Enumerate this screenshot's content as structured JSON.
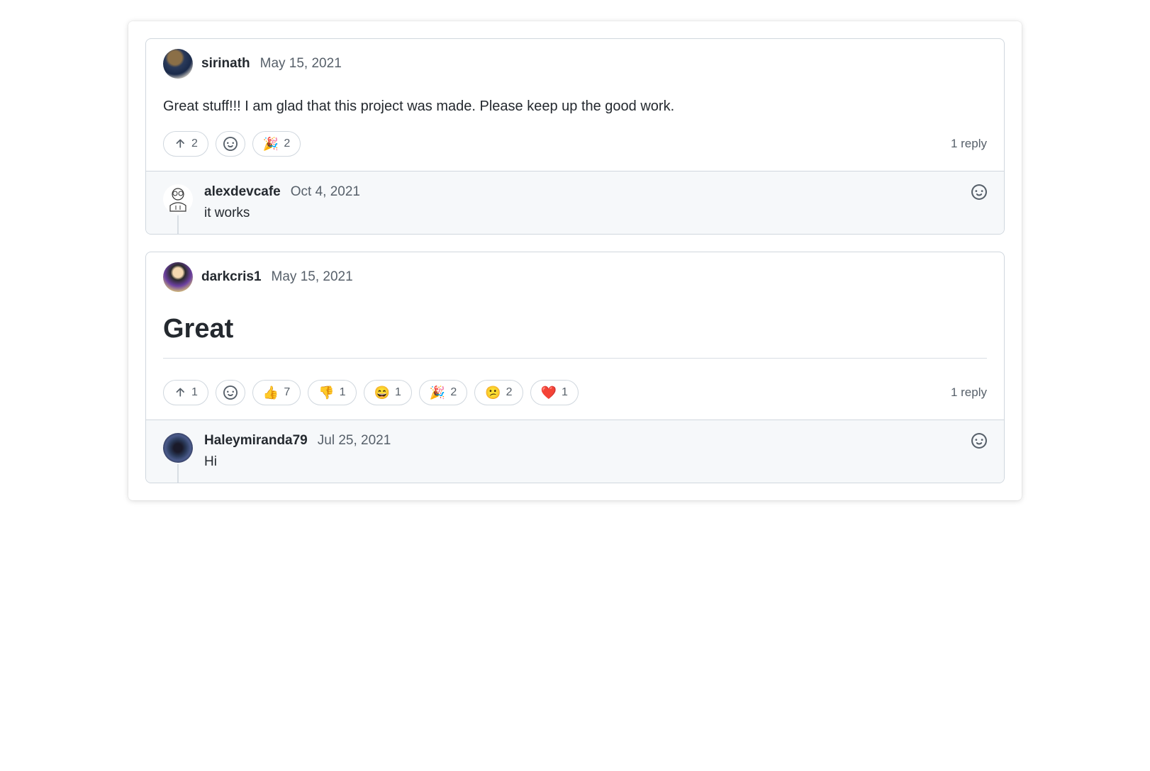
{
  "discussions": [
    {
      "author": "sirinath",
      "date": "May 15, 2021",
      "body": "Great stuff!!! I am glad that this project was made. Please keep up the good work.",
      "upvote": "2",
      "reactions": [
        {
          "emoji": "🎉",
          "count": "2"
        }
      ],
      "reply_count": "1 reply",
      "replies": [
        {
          "author": "alexdevcafe",
          "date": "Oct 4, 2021",
          "body": "it works"
        }
      ]
    },
    {
      "author": "darkcris1",
      "date": "May 15, 2021",
      "body_heading": "Great",
      "upvote": "1",
      "reactions": [
        {
          "emoji": "👍",
          "count": "7"
        },
        {
          "emoji": "👎",
          "count": "1"
        },
        {
          "emoji": "😄",
          "count": "1"
        },
        {
          "emoji": "🎉",
          "count": "2"
        },
        {
          "emoji": "😕",
          "count": "2"
        },
        {
          "emoji": "❤️",
          "count": "1"
        }
      ],
      "reply_count": "1 reply",
      "replies": [
        {
          "author": "Haleymiranda79",
          "date": "Jul 25, 2021",
          "body": "Hi"
        }
      ]
    }
  ]
}
